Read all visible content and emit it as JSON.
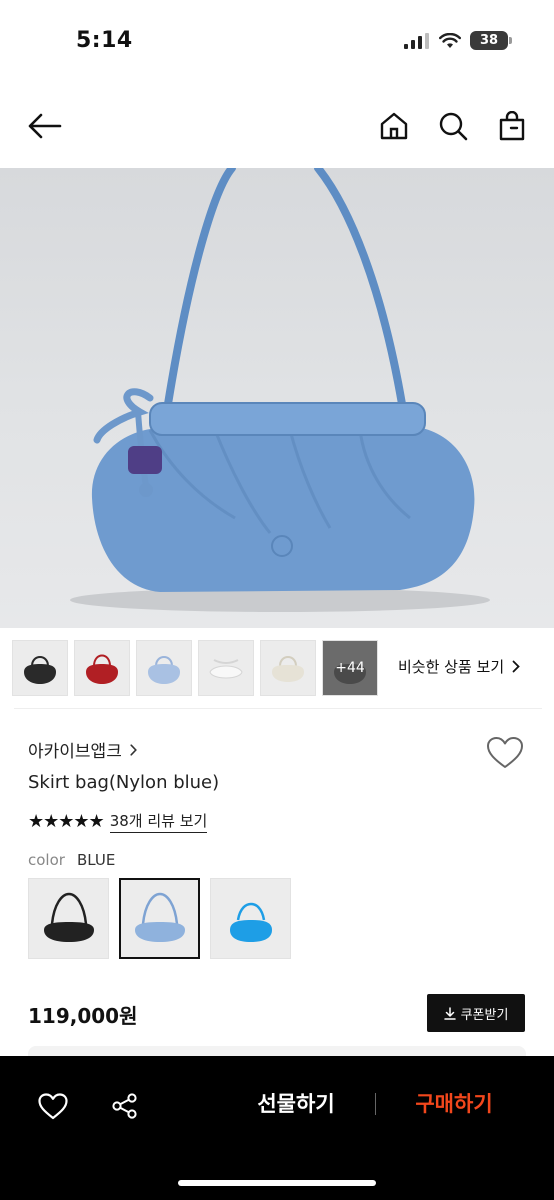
{
  "status_bar": {
    "time": "5:14",
    "battery": "38"
  },
  "header": {
    "icons": [
      "back-arrow-icon",
      "home-icon",
      "search-icon",
      "shopping-bag-icon"
    ]
  },
  "gallery": {
    "more_count": "+44",
    "similar_link": "비슷한 상품 보기",
    "thumbnail_colors": [
      "#2a2a2a",
      "#b11f24",
      "#a9c1e3",
      "#eeeeee",
      "#e6e2d6",
      "#5d5d5d"
    ]
  },
  "product": {
    "brand": "아카이브앱크",
    "name": "Skirt bag(Nylon blue)",
    "stars": "★★★★★",
    "review_link": "38개 리뷰 보기",
    "color_label": "color",
    "color_value": "BLUE",
    "swatch_colors": [
      "#222222",
      "#8fb2dd",
      "#1e9ee6"
    ],
    "price": "119,000원",
    "coupon_label": "쿠폰받기",
    "hero_bag_color": "#6f9bcf"
  },
  "bottom_bar": {
    "gift_label": "선물하기",
    "buy_label": "구매하기",
    "accent_color": "#f2471c"
  }
}
